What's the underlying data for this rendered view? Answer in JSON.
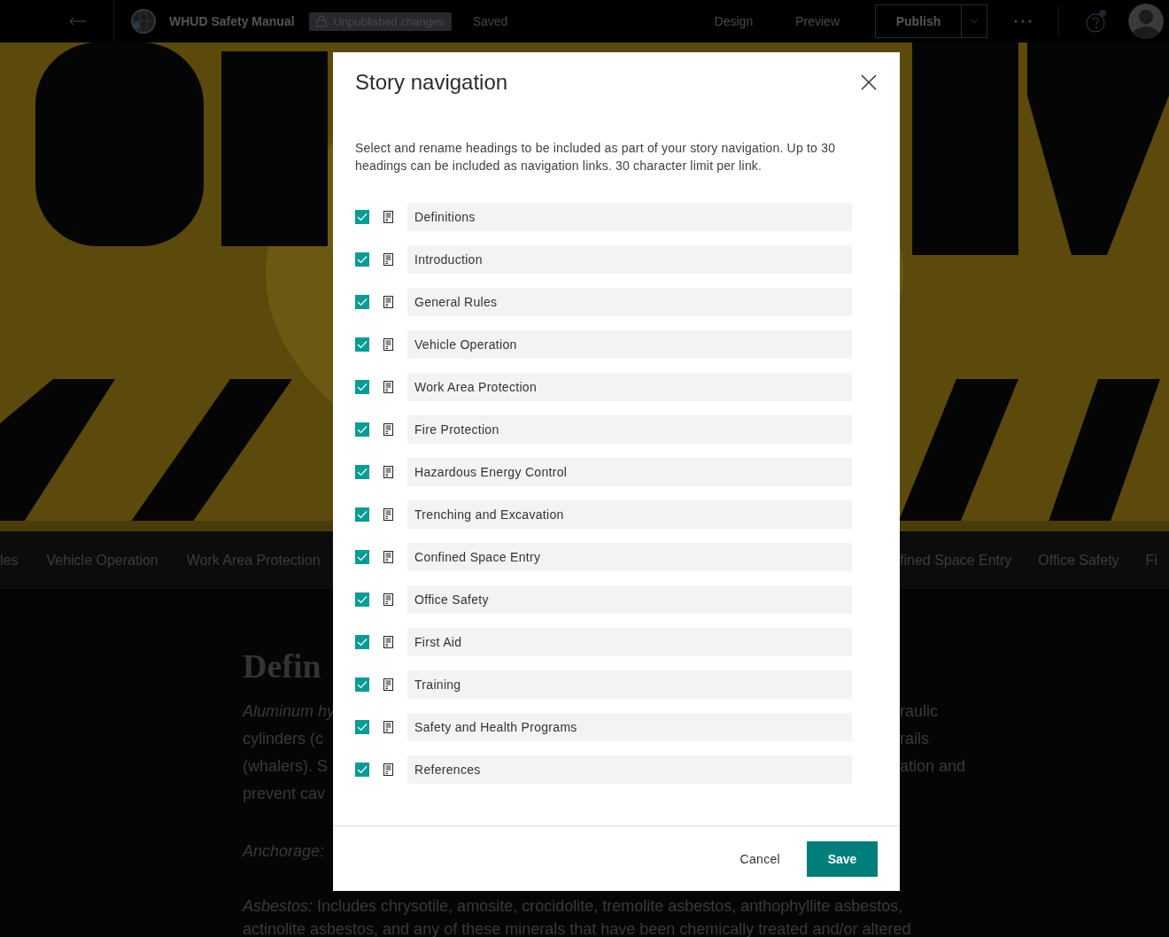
{
  "top_bar": {
    "title": "WHUD Safety Manual",
    "status_badge": "Unpublished changes",
    "save_status": "Saved",
    "links": [
      "Design",
      "Preview"
    ],
    "publish_button": "Publish"
  },
  "story_nav_bar": {
    "left_items": [
      "les",
      "Vehicle Operation",
      "Work Area Protection"
    ],
    "right_items": [
      "fined Space Entry",
      "Office Safety",
      "Fi"
    ]
  },
  "content": {
    "heading": "Defin",
    "paragraph_left": [
      "*Aluminum hy*",
      "cylinders (c",
      "(whalers). S",
      "prevent cav"
    ],
    "paragraph_right": [
      "raulic",
      "rails",
      "ation and"
    ],
    "anchorage": "*Anchorage:*",
    "asbestos_lines": [
      "*Asbestos:* Includes chrysotile, amosite, crocidolite, tremolite asbestos, anthophyllite asbestos,",
      "actinolite asbestos, and any of these minerals that have been chemically treated and/or altered"
    ]
  },
  "dialog": {
    "title": "Story navigation",
    "description": "Select and rename headings to be included as part of your story navigation. Up to 30 headings can be included as navigation links. 30 character limit per link.",
    "items": [
      {
        "label": "Definitions",
        "checked": true
      },
      {
        "label": "Introduction",
        "checked": true
      },
      {
        "label": "General Rules",
        "checked": true
      },
      {
        "label": "Vehicle Operation",
        "checked": true
      },
      {
        "label": "Work Area Protection",
        "checked": true
      },
      {
        "label": "Fire Protection",
        "checked": true
      },
      {
        "label": "Hazardous Energy Control",
        "checked": true
      },
      {
        "label": "Trenching and Excavation",
        "checked": true
      },
      {
        "label": "Confined Space Entry",
        "checked": true
      },
      {
        "label": "Office Safety",
        "checked": true
      },
      {
        "label": "First Aid",
        "checked": true
      },
      {
        "label": "Training",
        "checked": true
      },
      {
        "label": "Safety and Health Programs",
        "checked": true
      },
      {
        "label": "References",
        "checked": true
      }
    ],
    "cancel_button": "Cancel",
    "save_button": "Save"
  }
}
